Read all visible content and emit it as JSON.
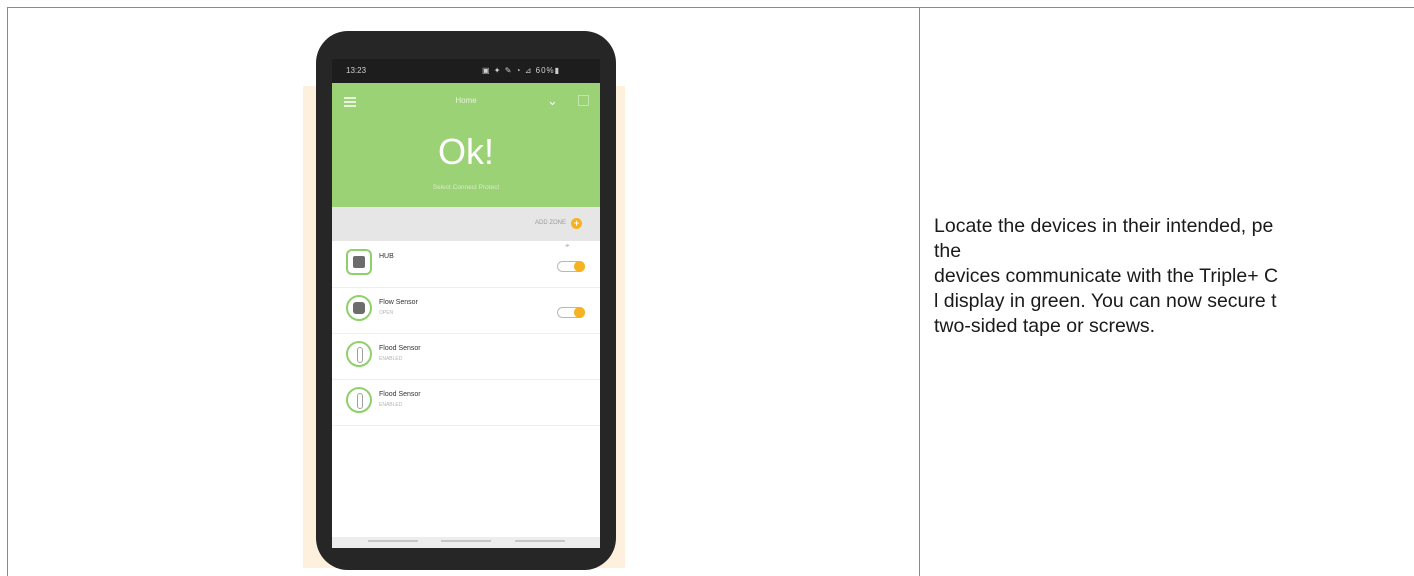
{
  "instruction_lines": [
    "Locate the devices in their intended, pe",
    "the",
    "devices communicate with the Triple+ C",
    "l display in green. You can now secure t",
    "two-sided tape or screws."
  ],
  "phone": {
    "status_time": "13:23",
    "status_icons": "▣ ✦ ✎ ◔ ⊿ 60%▮",
    "header_title": "Home",
    "status_big": "Ok!",
    "status_sub": "Select Connect Protect",
    "add_zone_label": "ADD ZONE",
    "devices": [
      {
        "name": "HUB",
        "state": "",
        "icon": "hub-icon",
        "toggle_on": true
      },
      {
        "name": "Flow Sensor",
        "state": "OPEN",
        "icon": "flow-sensor-icon",
        "toggle_on": true
      },
      {
        "name": "Flood Sensor",
        "state": "ENABLED",
        "icon": "flood-sensor-icon",
        "toggle_on": false
      },
      {
        "name": "Flood Sensor",
        "state": "ENABLED",
        "icon": "flood-sensor-icon",
        "toggle_on": false
      }
    ]
  },
  "colors": {
    "header_green": "#9cd276",
    "accent_yellow": "#f5b223",
    "phone_body": "#262626"
  }
}
